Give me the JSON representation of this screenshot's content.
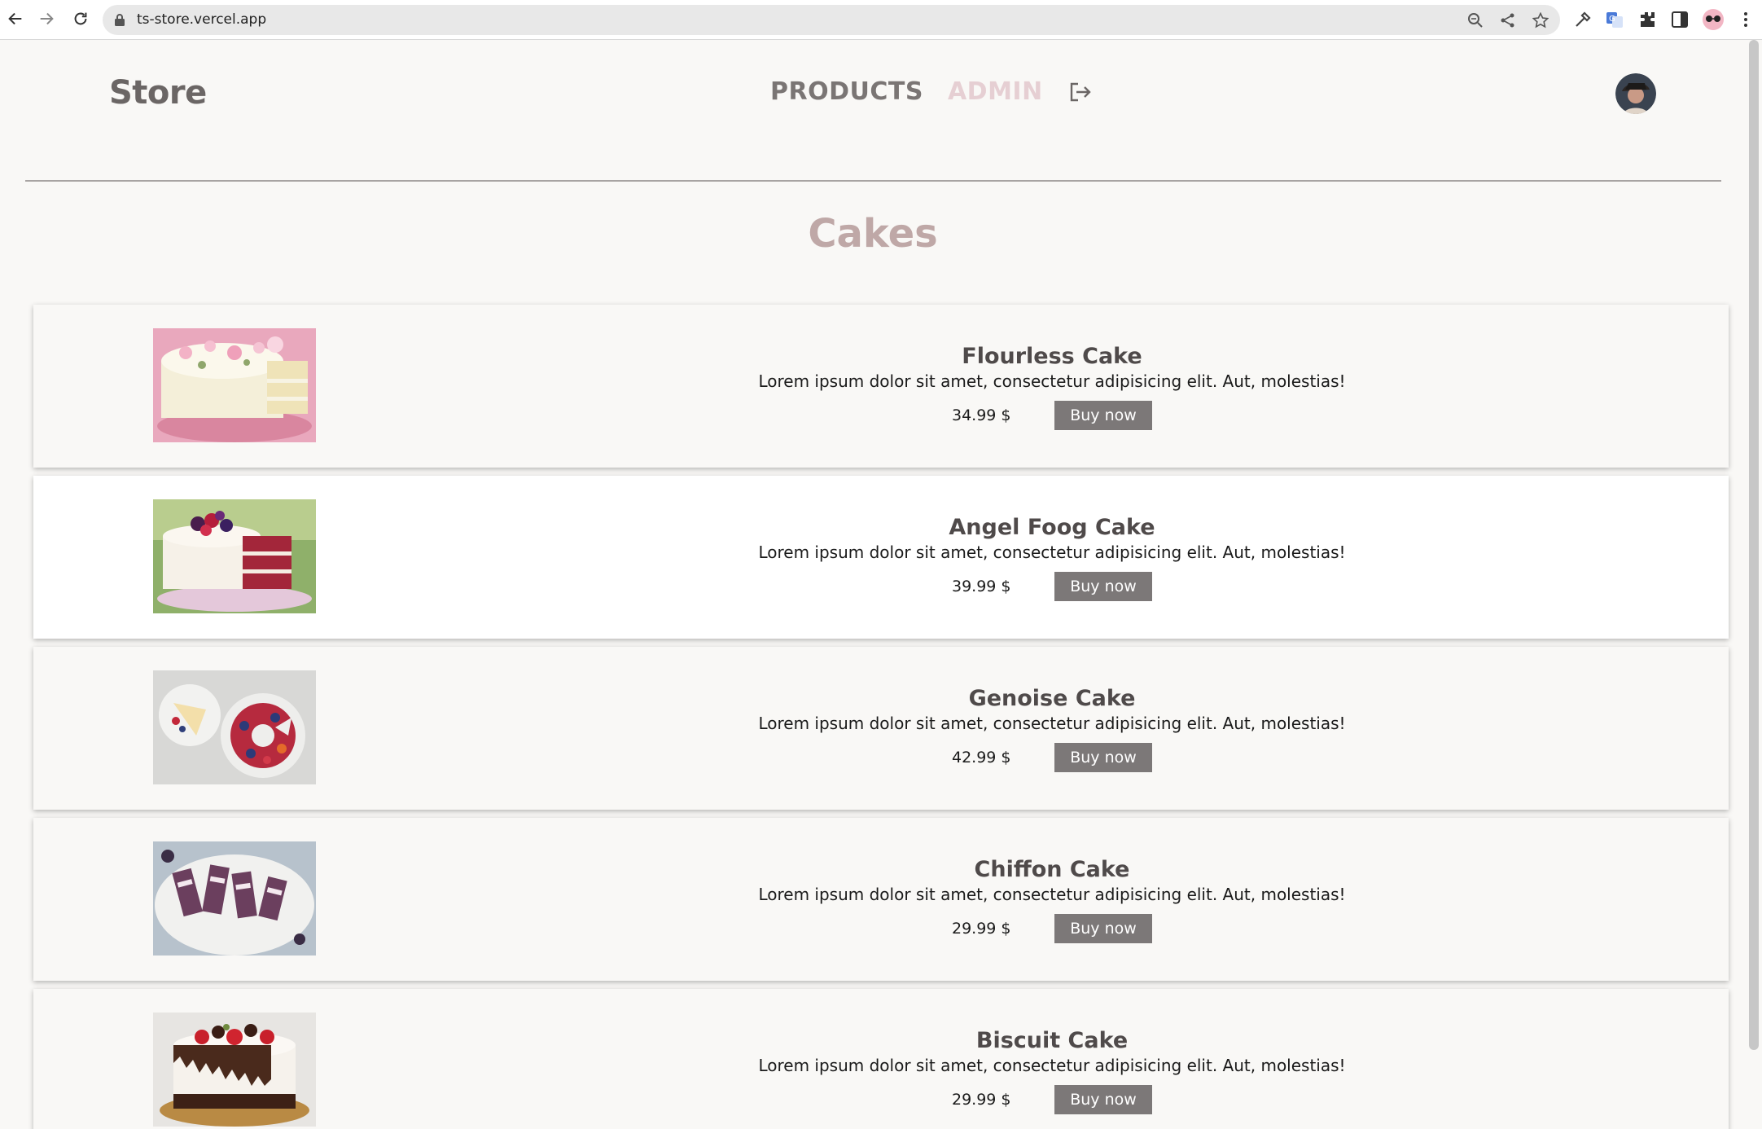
{
  "browser": {
    "url": "ts-store.vercel.app"
  },
  "header": {
    "brand": "Store",
    "nav": {
      "products": "PRODUCTS",
      "admin": "ADMIN"
    }
  },
  "category": {
    "title": "Cakes"
  },
  "products": [
    {
      "name": "Flourless Cake",
      "description": "Lorem ipsum dolor sit amet, consectetur adipisicing elit. Aut, molestias!",
      "price": "34.99 $",
      "buy_label": "Buy now"
    },
    {
      "name": "Angel Foog Cake",
      "description": "Lorem ipsum dolor sit amet, consectetur adipisicing elit. Aut, molestias!",
      "price": "39.99 $",
      "buy_label": "Buy now"
    },
    {
      "name": "Genoise Cake",
      "description": "Lorem ipsum dolor sit amet, consectetur adipisicing elit. Aut, molestias!",
      "price": "42.99 $",
      "buy_label": "Buy now"
    },
    {
      "name": "Chiffon Cake",
      "description": "Lorem ipsum dolor sit amet, consectetur adipisicing elit. Aut, molestias!",
      "price": "29.99 $",
      "buy_label": "Buy now"
    },
    {
      "name": "Biscuit Cake",
      "description": "Lorem ipsum dolor sit amet, consectetur adipisicing elit. Aut, molestias!",
      "price": "29.99 $",
      "buy_label": "Buy now"
    }
  ],
  "icons": {
    "back": "arrow-left-icon",
    "forward": "arrow-right-icon",
    "reload": "reload-icon",
    "lock": "lock-icon",
    "zoom": "zoom-icon",
    "share": "share-icon",
    "bookmark": "star-icon",
    "logout": "logout-icon"
  },
  "colors": {
    "brand_text": "#6b6665",
    "admin_link": "#e6cfd3",
    "category_title": "#bfa8a7",
    "buy_button": "#7c7878"
  }
}
